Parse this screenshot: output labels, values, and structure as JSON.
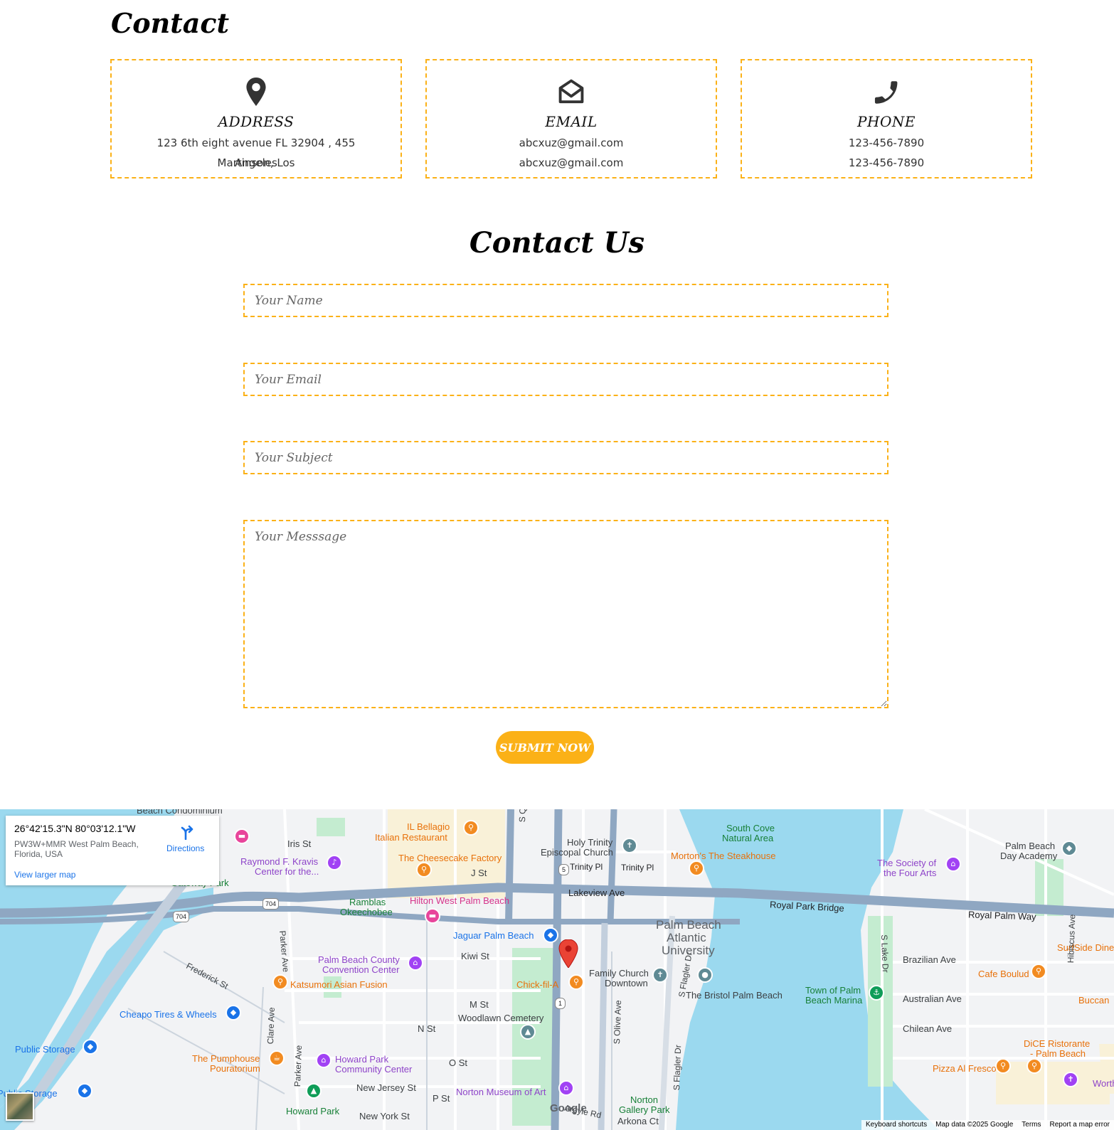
{
  "contact": {
    "title": "Contact",
    "cards": [
      {
        "icon": "location-pin-icon",
        "title": "ADDRESS",
        "line1": "123 6th eight avenue FL 32904 , 455 Martinson, Los",
        "line2": "Angeles"
      },
      {
        "icon": "envelope-open-icon",
        "title": "EMAIL",
        "line1": "abcxuz@gmail.com",
        "line2": "abcxuz@gmail.com"
      },
      {
        "icon": "phone-icon",
        "title": "PHONE",
        "line1": "123-456-7890",
        "line2": "123-456-7890"
      }
    ]
  },
  "form": {
    "title": "Contact Us",
    "name_placeholder": "Your Name",
    "email_placeholder": "Your Email",
    "subject_placeholder": "Your Subject",
    "message_placeholder": "Your Messsage",
    "submit_label": "SUBMIT NOW"
  },
  "colors": {
    "accent": "#fbb117",
    "water": "#9bd9ef",
    "park": "#c4ecd0"
  },
  "map": {
    "card": {
      "coords": "26°42'15.3\"N 80°03'12.1\"W",
      "address": "PW3W+MMR West Palm Beach, Florida, USA",
      "directions": "Directions",
      "larger_map": "View larger map"
    },
    "labels": {
      "beach_condo": "Beach Condominium",
      "iris": "Iris St",
      "il_bellagio": "IL Bellagio",
      "italian_restaurant": "Italian Restaurant",
      "kravis1": "Raymond F. Kravis",
      "kravis2": "Center for the...",
      "cheesecake": "The Cheesecake Factory",
      "j_st": "J St",
      "holy_trinity1": "Holy Trinity",
      "holy_trinity2": "Episcopal Church",
      "trinity_pl1": "Trinity Pl",
      "trinity_pl2": "Trinity Pl",
      "mortons": "Morton's The Steakhouse",
      "south_cove1": "South Cove",
      "south_cove2": "Natural Area",
      "four_arts1": "The Society of",
      "four_arts2": "the Four Arts",
      "pb_day1": "Palm Beach",
      "pb_day2": "Day Academy",
      "gateway_park": "Gateway Park",
      "lakeview": "Lakeview Ave",
      "ramblas1": "Ramblas",
      "ramblas2": "Okeechobee",
      "hilton": "Hilton West Palm Beach",
      "royal_bridge": "Royal Park Bridge",
      "royal_way": "Royal Palm Way",
      "jaguar": "Jaguar Palm Beach",
      "pba1": "Palm Beach",
      "pba2": "Atlantic",
      "pba3": "University",
      "parker1": "Parker Ave",
      "parker2": "Parker Ave",
      "frederick": "Frederick St",
      "kiwi": "Kiwi St",
      "convention1": "Palm Beach County",
      "convention2": "Convention Center",
      "katsumori": "Katsumori Asian Fusion",
      "family1": "Family Church",
      "family2": "Downtown",
      "chickfila": "Chick-fil-A",
      "bristol": "The Bristol Palm Beach",
      "marina1": "Town of Palm",
      "marina2": "Beach Marina",
      "s_lake": "S Lake Dr",
      "brazilian": "Brazilian Ave",
      "surfside": "SurfSide Diner",
      "cafe_boulud": "Cafe Boulud",
      "australian": "Australian Ave",
      "buccan": "Buccan",
      "hibiscus": "Hibiscus Ave",
      "cheapo": "Cheapo Tires & Wheels",
      "m_st": "M St",
      "woodlawn": "Woodlawn Cemetery",
      "clare": "Clare Ave",
      "s_olive": "S Olive Ave",
      "s_flagler1": "S Flagler Dr",
      "s_flagler2": "S Flagler Dr",
      "chilean": "Chilean Ave",
      "public_storage1": "Public Storage",
      "n_st": "N St",
      "pumphouse1": "The Pumphouse",
      "pumphouse2": "Pouratorium",
      "howard1": "Howard Park",
      "howard2": "Community Center",
      "o_st": "O St",
      "dice1": "DiCE Ristorante",
      "dice2": "- Palm Beach",
      "pizza": "Pizza Al Fresco",
      "worth": "Worth",
      "public_storage2": "Public Storage",
      "new_jersey": "New Jersey St",
      "norton_museum": "Norton Museum of Art",
      "p_st": "P St",
      "norton_park1": "Norton",
      "norton_park2": "Gallery Park",
      "howard_park": "Howard Park",
      "new_york": "New York St",
      "argyle": "Argyle Rd",
      "arkona": "Arkona Ct",
      "sq": "S Q",
      "route_704a": "704",
      "route_704b": "704",
      "route_5": "5",
      "route_1": "1"
    },
    "google": "Google",
    "footer": {
      "shortcuts": "Keyboard shortcuts",
      "data": "Map data ©2025 Google",
      "terms": "Terms",
      "report": "Report a map error"
    }
  }
}
